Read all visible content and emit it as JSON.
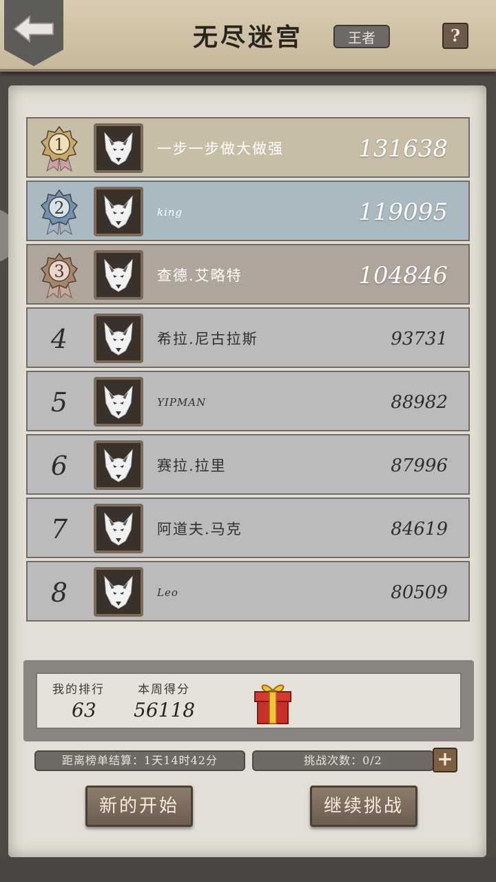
{
  "header": {
    "title": "无尽迷宫",
    "league": "王者",
    "help_label": "?"
  },
  "leaderboard": [
    {
      "rank": "1",
      "name": "一步一步做大做强",
      "score": "131638",
      "tier": "gold"
    },
    {
      "rank": "2",
      "name": "king",
      "score": "119095",
      "tier": "silver"
    },
    {
      "rank": "3",
      "name": "查德.艾略特",
      "score": "104846",
      "tier": "bronze"
    },
    {
      "rank": "4",
      "name": "希拉.尼古拉斯",
      "score": "93731",
      "tier": "normal"
    },
    {
      "rank": "5",
      "name": "YIPMAN",
      "score": "88982",
      "tier": "normal"
    },
    {
      "rank": "6",
      "name": "赛拉.拉里",
      "score": "87996",
      "tier": "normal"
    },
    {
      "rank": "7",
      "name": "阿道夫.马克",
      "score": "84619",
      "tier": "normal"
    },
    {
      "rank": "8",
      "name": "Leo",
      "score": "80509",
      "tier": "normal"
    }
  ],
  "my_stats": {
    "rank_label": "我的排行",
    "rank_value": "63",
    "weekly_label": "本周得分",
    "weekly_value": "56118"
  },
  "countdown": {
    "text": "距离榜单结算：1天14时42分"
  },
  "challenges": {
    "text": "挑战次数：0/2",
    "plus_label": "+"
  },
  "buttons": {
    "new_start": "新的开始",
    "continue": "继续挑战"
  },
  "colors": {
    "gold_row": "#c8bea8",
    "silver_row": "#aabac2",
    "bronze_row": "#b0a59b",
    "normal_row": "#bbbbbb"
  }
}
